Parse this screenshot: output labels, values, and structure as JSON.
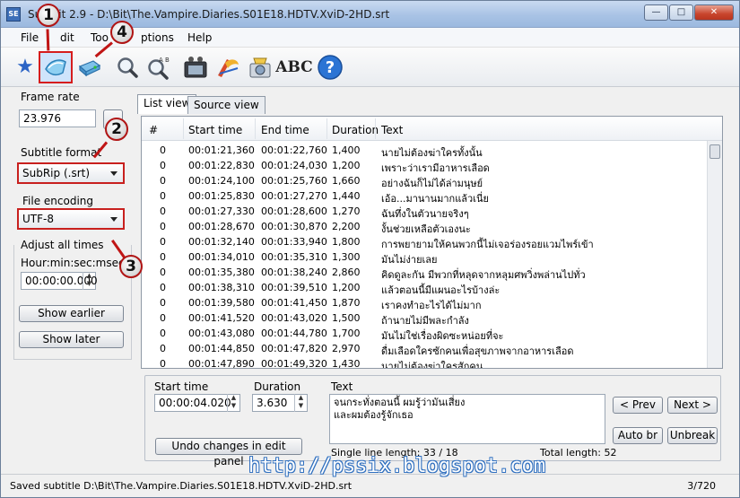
{
  "window": {
    "title": "Subtitle Edit 2.9 - D:\\Bit\\The.Vampire.Diaries.S01E18.HDTV.XviD-2HD.srt",
    "title_visible": "Su         Edit 2.9 - D:\\Bit\\The.Vampire.Diaries.S01E18.HDTV.XviD-2HD.srt",
    "app_icon": "SE",
    "controls": {
      "minimize": "—",
      "maximize": "□",
      "close": "✕"
    }
  },
  "menu": [
    "File",
    "Edit",
    "Tools",
    "Options",
    "Help"
  ],
  "menu_visible": [
    "File",
    "dit",
    "Too",
    "ptions",
    "Help"
  ],
  "toolbar": {
    "buttons": [
      {
        "name": "new-icon",
        "glyph": "★"
      },
      {
        "name": "open-icon",
        "glyph": "📂"
      },
      {
        "name": "save-icon",
        "glyph": "💾"
      },
      {
        "name": "find-icon",
        "glyph": "🔍"
      },
      {
        "name": "replace-icon",
        "glyph": "🔎"
      },
      {
        "name": "video-icon",
        "glyph": "🎬"
      },
      {
        "name": "spellcheck-icon",
        "glyph": "✎"
      },
      {
        "name": "settings-icon",
        "glyph": "⚙"
      },
      {
        "name": "abc-icon",
        "glyph": "ABC"
      },
      {
        "name": "help-icon",
        "glyph": "?"
      }
    ]
  },
  "left": {
    "frame_rate_label": "Frame rate",
    "frame_rate_value": "23.976",
    "subtitle_format_label": "Subtitle format",
    "subtitle_format_value": "SubRip (.srt)",
    "file_encoding_label": "File encoding",
    "file_encoding_value": "UTF-8",
    "adjust_label": "Adjust all times",
    "hms_label": "Hour:min:sec:msec",
    "adjust_value": "00:00:00.000",
    "show_earlier": "Show earlier",
    "show_later": "Show later"
  },
  "tabs": [
    "List view",
    "Source view"
  ],
  "list": {
    "columns": [
      "#",
      "Start time",
      "End time",
      "Duration",
      "Text"
    ],
    "rows": [
      [
        "0",
        "00:01:21,360",
        "00:01:22,760",
        "1,400",
        "นายไม่ต้องฆ่าใครทั้งนั้น"
      ],
      [
        "0",
        "00:01:22,830",
        "00:01:24,030",
        "1,200",
        "เพราะว่าเรามีอาหารเลือด"
      ],
      [
        "0",
        "00:01:24,100",
        "00:01:25,760",
        "1,660",
        "อย่างฉันก็ไม่ได้ล่ามนุษย์"
      ],
      [
        "0",
        "00:01:25,830",
        "00:01:27,270",
        "1,440",
        "เอ้อ...มานานมากแล้วเนี่ย"
      ],
      [
        "0",
        "00:01:27,330",
        "00:01:28,600",
        "1,270",
        "ฉันทึ่งในตัวนายจริงๆ"
      ],
      [
        "0",
        "00:01:28,670",
        "00:01:30,870",
        "2,200",
        "งั้นช่วยเหลือตัวเองนะ"
      ],
      [
        "0",
        "00:01:32,140",
        "00:01:33,940",
        "1,800",
        "การพยายามให้คนพวกนี้ไม่เจอร่องรอยแวมไพร์เข้า"
      ],
      [
        "0",
        "00:01:34,010",
        "00:01:35,310",
        "1,300",
        "มันไม่ง่ายเลย"
      ],
      [
        "0",
        "00:01:35,380",
        "00:01:38,240",
        "2,860",
        "คิดดูละกัน มีพวกที่หลุดจากหลุมศพวิ่งพล่านไปทั่ว"
      ],
      [
        "0",
        "00:01:38,310",
        "00:01:39,510",
        "1,200",
        "แล้วตอนนี้มีแผนอะไรบ้างล่ะ"
      ],
      [
        "0",
        "00:01:39,580",
        "00:01:41,450",
        "1,870",
        "เราคงทำอะไรได้ไม่มาก"
      ],
      [
        "0",
        "00:01:41,520",
        "00:01:43,020",
        "1,500",
        "ถ้านายไม่มีพละกำลัง"
      ],
      [
        "0",
        "00:01:43,080",
        "00:01:44,780",
        "1,700",
        "มันไม่ใช่เรื่องผิดซะหน่อยที่จะ"
      ],
      [
        "0",
        "00:01:44,850",
        "00:01:47,820",
        "2,970",
        "ดื่มเลือดใครซักคนเพื่อสุขภาพจากอาหารเลือด"
      ],
      [
        "0",
        "00:01:47,890",
        "00:01:49,320",
        "1,430",
        "นายไม่ต้องฆ่าใครสักคน"
      ]
    ]
  },
  "edit": {
    "start_time_label": "Start time",
    "start_time_value": "00:00:04.020",
    "duration_label": "Duration",
    "duration_value": "3.630",
    "text_label": "Text",
    "text_line1": "จนกระทั่งตอนนี้ ผมรู้ว่ามันเสี่ยง",
    "text_line2": "และผมต้องรู้จักเธอ",
    "undo": "Undo changes in edit panel",
    "single_line": "Single line length: 33 / 18",
    "total_length": "Total length: 52",
    "prev": "< Prev",
    "next": "Next >",
    "auto_br": "Auto br",
    "unbreak": "Unbreak"
  },
  "callouts": [
    "1",
    "2",
    "3",
    "4"
  ],
  "watermark": "http://pssix.blogspot.com",
  "status": {
    "text": "Saved subtitle D:\\Bit\\The.Vampire.Diaries.S01E18.HDTV.XviD-2HD.srt",
    "position": "3/720"
  },
  "colors": {
    "callout_red": "#c01515",
    "selection_highlight": "#cfe4fb"
  }
}
